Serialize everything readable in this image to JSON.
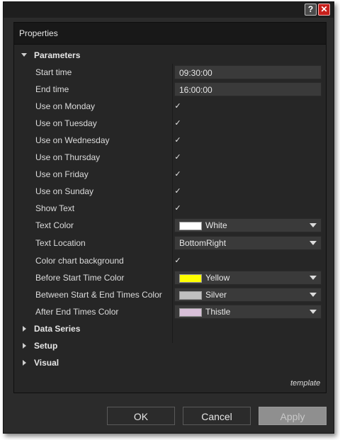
{
  "titlebar": {
    "help_glyph": "?",
    "close_glyph": "✕"
  },
  "panel": {
    "title": "Properties"
  },
  "sections": {
    "parameters": "Parameters",
    "data_series": "Data Series",
    "setup": "Setup",
    "visual": "Visual"
  },
  "fields": {
    "start_time": {
      "label": "Start time",
      "value": "09:30:00"
    },
    "end_time": {
      "label": "End time",
      "value": "16:00:00"
    },
    "use_monday": {
      "label": "Use on Monday",
      "checked": true
    },
    "use_tuesday": {
      "label": "Use on Tuesday",
      "checked": true
    },
    "use_wednesday": {
      "label": "Use on Wednesday",
      "checked": true
    },
    "use_thursday": {
      "label": "Use on Thursday",
      "checked": true
    },
    "use_friday": {
      "label": "Use on Friday",
      "checked": true
    },
    "use_sunday": {
      "label": "Use on Sunday",
      "checked": true
    },
    "show_text": {
      "label": "Show Text",
      "checked": true
    },
    "text_color": {
      "label": "Text Color",
      "value": "White",
      "swatch": "#ffffff"
    },
    "text_location": {
      "label": "Text Location",
      "value": "BottomRight"
    },
    "color_chart_background": {
      "label": "Color chart background",
      "checked": true
    },
    "before_start_color": {
      "label": "Before Start Time Color",
      "value": "Yellow",
      "swatch": "#ffff00"
    },
    "between_color": {
      "label": "Between Start & End Times Color",
      "value": "Silver",
      "swatch": "#c0c0c0"
    },
    "after_end_color": {
      "label": "After End Times Color",
      "value": "Thistle",
      "swatch": "#d8bfd8"
    }
  },
  "check_glyph": "✓",
  "template_label": "template",
  "buttons": {
    "ok": "OK",
    "cancel": "Cancel",
    "apply": "Apply"
  }
}
